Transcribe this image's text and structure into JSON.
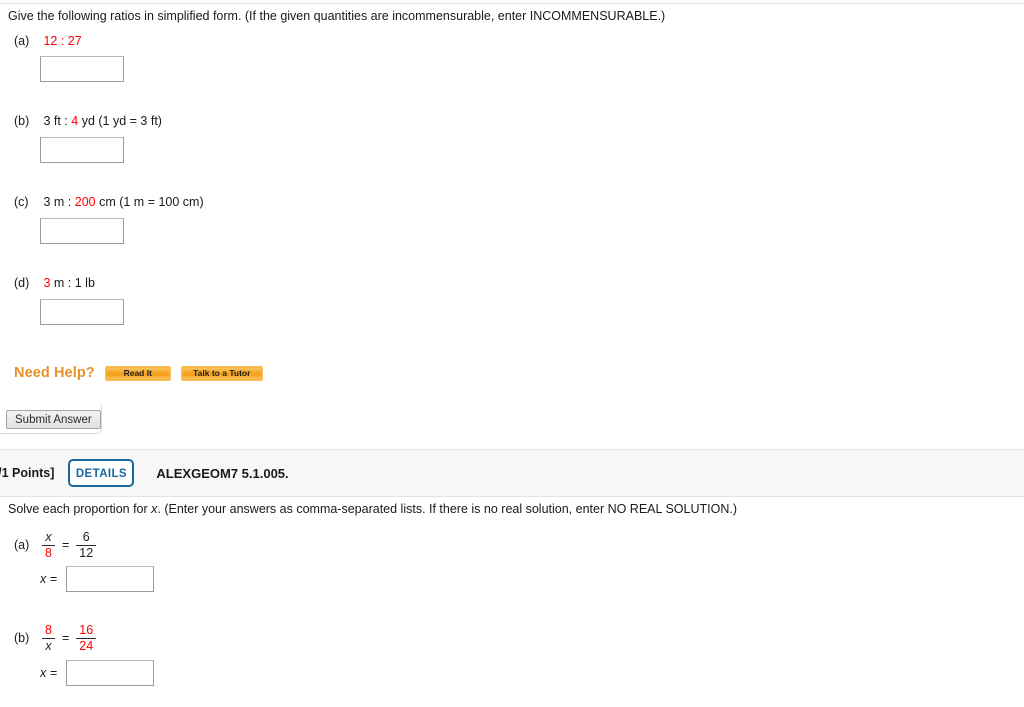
{
  "question1": {
    "prompt": "Give the following ratios in simplified form. (If the given quantities are incommensurable, enter INCOMMENSURABLE.)",
    "parts": [
      {
        "label": "(a)",
        "segments": [
          {
            "text": "12 : 27",
            "color": "red"
          }
        ],
        "answer_value": "",
        "answer_placeholder": ""
      },
      {
        "label": "(b)",
        "segments": [
          {
            "text": "3 ft : ",
            "color": "black"
          },
          {
            "text": "4",
            "color": "red"
          },
          {
            "text": " yd (1 yd = 3 ft)",
            "color": "black"
          }
        ],
        "answer_value": "",
        "answer_placeholder": ""
      },
      {
        "label": "(c)",
        "segments": [
          {
            "text": "3 m : ",
            "color": "black"
          },
          {
            "text": "200",
            "color": "red"
          },
          {
            "text": " cm (1 m = 100 cm)",
            "color": "black"
          }
        ],
        "answer_value": "",
        "answer_placeholder": ""
      },
      {
        "label": "(d)",
        "segments": [
          {
            "text": "3",
            "color": "red"
          },
          {
            "text": " m : 1 lb",
            "color": "black"
          }
        ],
        "answer_value": "",
        "answer_placeholder": ""
      }
    ],
    "need_help": {
      "label": "Need Help?",
      "read_it": "Read It",
      "talk_to_tutor": "Talk to a Tutor"
    },
    "submit_label": "Submit Answer"
  },
  "detail_bar": {
    "points": "-/1 Points]",
    "details_label": "DETAILS",
    "module_code": "ALEXGEOM7 5.1.005."
  },
  "question2": {
    "prompt_before": "Solve each proportion for ",
    "prompt_var": "x",
    "prompt_after": ". (Enter your answers as comma-separated lists. If there is no real solution, enter NO REAL SOLUTION.)",
    "parts": [
      {
        "label": "(a)",
        "left": {
          "num": "x",
          "num_color": "black",
          "num_italic": true,
          "den": "8",
          "den_color": "red",
          "den_italic": false
        },
        "equals": "=",
        "right": {
          "num": "6",
          "num_color": "black",
          "num_italic": false,
          "den": "12",
          "den_color": "black",
          "den_italic": false
        },
        "x_label": "x =",
        "answer_value": "",
        "answer_placeholder": ""
      },
      {
        "label": "(b)",
        "left": {
          "num": "8",
          "num_color": "red",
          "num_italic": false,
          "den": "x",
          "den_color": "black",
          "den_italic": true
        },
        "equals": "=",
        "right": {
          "num": "16",
          "num_color": "red",
          "num_italic": false,
          "den": "24",
          "den_color": "red",
          "den_italic": false
        },
        "x_label": "x =",
        "answer_value": "",
        "answer_placeholder": ""
      }
    ]
  },
  "colors": {
    "red": "#ff0000",
    "orange": "#e8912b",
    "details_blue": "#17699e",
    "bar_bg": "#f7f7f7"
  }
}
